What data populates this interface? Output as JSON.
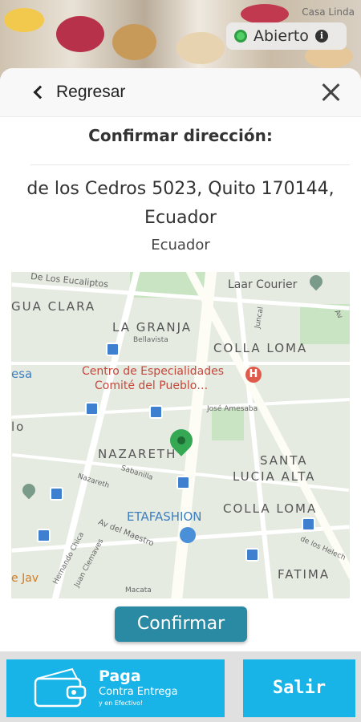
{
  "background": {
    "shop_name": "Casa Linda",
    "status": "Abierto"
  },
  "modal": {
    "back_label": "Regresar",
    "title": "Confirmar dirección:",
    "address_line": "de los Cedros 5023, Quito 170144, Ecuador",
    "address_sub": "Ecuador",
    "confirm_label": "Confirmar"
  },
  "map": {
    "labels": {
      "eucaliptos": "De Los Eucaliptos",
      "laar": "Laar Courier",
      "agua_clara": "GUA CLARA",
      "la_granja": "LA GRANJA",
      "juncal": "Juncal",
      "av_top": "Av",
      "bellavista": "Bellavista",
      "colla_loma_1": "COLLA LOMA",
      "esa": "esa",
      "centro_1": "Centro de Especialidades",
      "centro_2": "Comité del Pueblo…",
      "lo": "lo",
      "jose_amesaba": "José Amesaba",
      "nazareth_district": "NAZARETH",
      "santa": "SANTA",
      "lucia_alta": "LUCIA ALTA",
      "sabanilla": "Sabanilla",
      "nazareth_street": "Nazareth",
      "etafashion": "ETAFASHION",
      "colla_loma_2": "COLLA LOMA",
      "hernando": "Hernando Chica",
      "juan_clemaves": "Juan Clemaves",
      "av_maestro": "Av del Maestro",
      "de_los_helech": "de los Helech",
      "fatima": "FATIMA",
      "javier": "e Jav",
      "macata": "Macata"
    }
  },
  "footer": {
    "pay_title": "Paga",
    "pay_sub": "Contra Entrega",
    "pay_sub2": "y en Efectivo!",
    "exit_label": "Salir"
  }
}
